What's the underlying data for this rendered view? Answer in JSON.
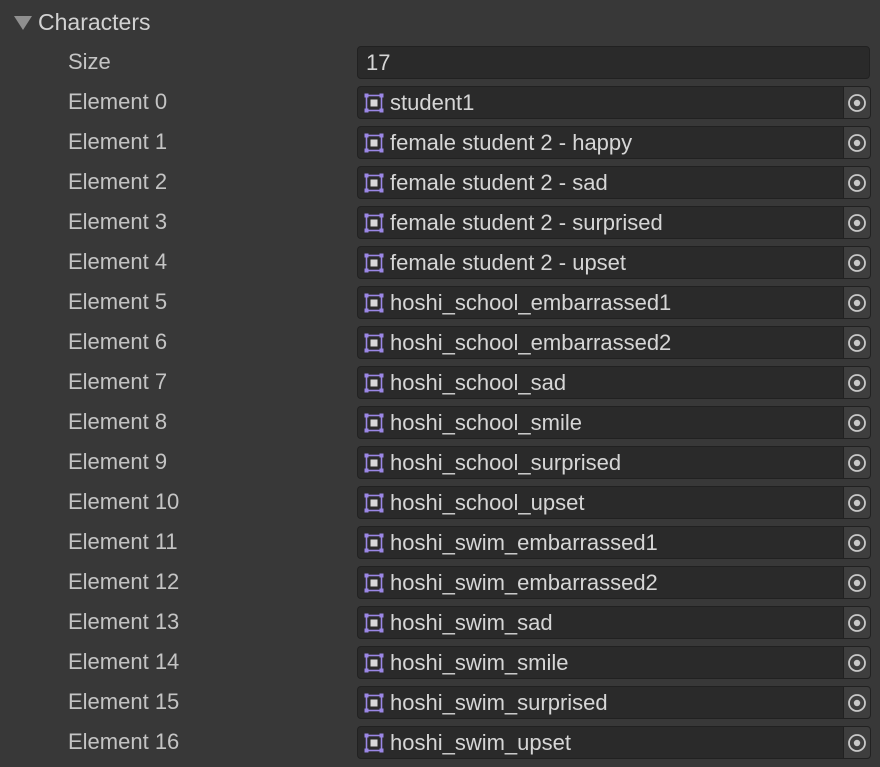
{
  "foldout": {
    "title": "Characters",
    "icon": "triangle-down-icon"
  },
  "size": {
    "label": "Size",
    "value": "17"
  },
  "elements": [
    {
      "label": "Element 0",
      "value": "student1"
    },
    {
      "label": "Element 1",
      "value": "female student 2 - happy"
    },
    {
      "label": "Element 2",
      "value": "female student 2 - sad"
    },
    {
      "label": "Element 3",
      "value": "female student 2 - surprised"
    },
    {
      "label": "Element 4",
      "value": "female student 2 - upset"
    },
    {
      "label": "Element 5",
      "value": "hoshi_school_embarrassed1"
    },
    {
      "label": "Element 6",
      "value": "hoshi_school_embarrassed2"
    },
    {
      "label": "Element 7",
      "value": "hoshi_school_sad"
    },
    {
      "label": "Element 8",
      "value": "hoshi_school_smile"
    },
    {
      "label": "Element 9",
      "value": "hoshi_school_surprised"
    },
    {
      "label": "Element 10",
      "value": "hoshi_school_upset"
    },
    {
      "label": "Element 11",
      "value": "hoshi_swim_embarrassed1"
    },
    {
      "label": "Element 12",
      "value": "hoshi_swim_embarrassed2"
    },
    {
      "label": "Element 13",
      "value": "hoshi_swim_sad"
    },
    {
      "label": "Element 14",
      "value": "hoshi_swim_smile"
    },
    {
      "label": "Element 15",
      "value": "hoshi_swim_surprised"
    },
    {
      "label": "Element 16",
      "value": "hoshi_swim_upset"
    }
  ],
  "icons": {
    "object_icon": "sprite-icon",
    "picker_icon": "object-picker-target-icon"
  },
  "colors": {
    "background": "#383838",
    "field_background": "#2a2a2a",
    "text": "#c4c4c4",
    "sprite_icon": "#9b87e6"
  }
}
